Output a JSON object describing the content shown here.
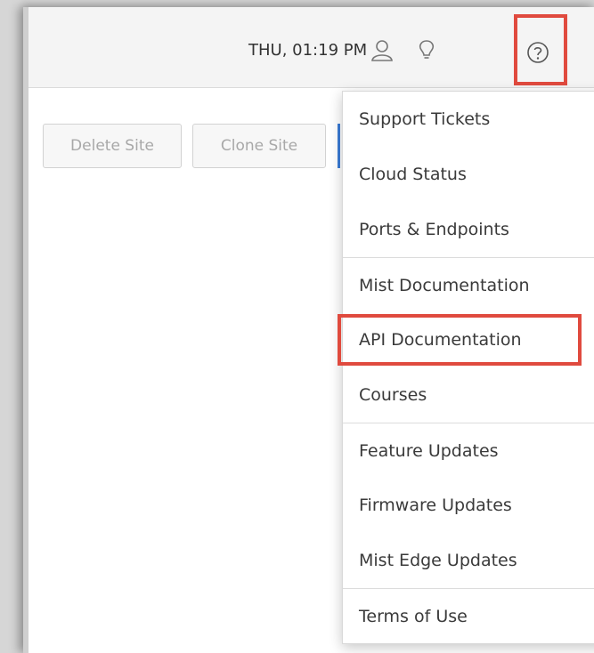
{
  "header": {
    "datetime": "THU, 01:19 PM",
    "icons": [
      "user-icon",
      "lightbulb-icon",
      "help-icon"
    ]
  },
  "toolbar": {
    "delete_label": "Delete Site",
    "clone_label": "Clone Site"
  },
  "help_menu": {
    "items": [
      {
        "label": "Support Tickets"
      },
      {
        "label": "Cloud Status"
      },
      {
        "label": "Ports & Endpoints"
      },
      {
        "label": "Mist Documentation"
      },
      {
        "label": "API Documentation",
        "highlighted": true
      },
      {
        "label": "Courses"
      },
      {
        "label": "Feature Updates"
      },
      {
        "label": "Firmware Updates"
      },
      {
        "label": "Mist Edge Updates"
      },
      {
        "label": "Terms of Use"
      }
    ]
  },
  "colors": {
    "highlight": "#e04a3e",
    "text": "#3a3a3a",
    "disabled_text": "#a8a8a8",
    "accent": "#3a7bd5"
  }
}
